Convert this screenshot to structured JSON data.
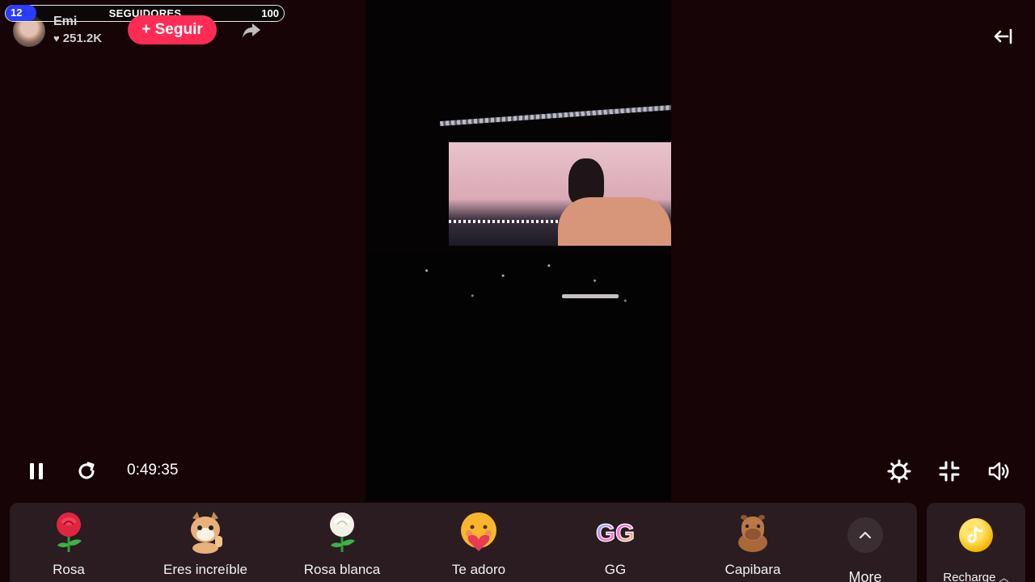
{
  "followers_goal": {
    "current": "12",
    "label": "SEGUIDORES",
    "goal": "100"
  },
  "host": {
    "name": "Emi",
    "likes": "251.2K",
    "follow_label": "+ Seguir"
  },
  "player": {
    "elapsed": "0:49:35"
  },
  "gifts": [
    {
      "label": "Rosa",
      "icon": "rose-icon"
    },
    {
      "label": "Eres increíble",
      "icon": "cat-thumbs-up-icon"
    },
    {
      "label": "Rosa blanca",
      "icon": "white-rose-icon"
    },
    {
      "label": "Te adoro",
      "icon": "hugging-heart-icon"
    },
    {
      "label": "GG",
      "icon": "gg-icon"
    },
    {
      "label": "Capibara",
      "icon": "capybara-icon"
    }
  ],
  "more_label": "More",
  "recharge_label": "Recharge",
  "colors": {
    "accent": "#fe2c55",
    "background": "#160407",
    "gift_bar": "#2a1c20",
    "followers_badge": "#2a3cff"
  }
}
